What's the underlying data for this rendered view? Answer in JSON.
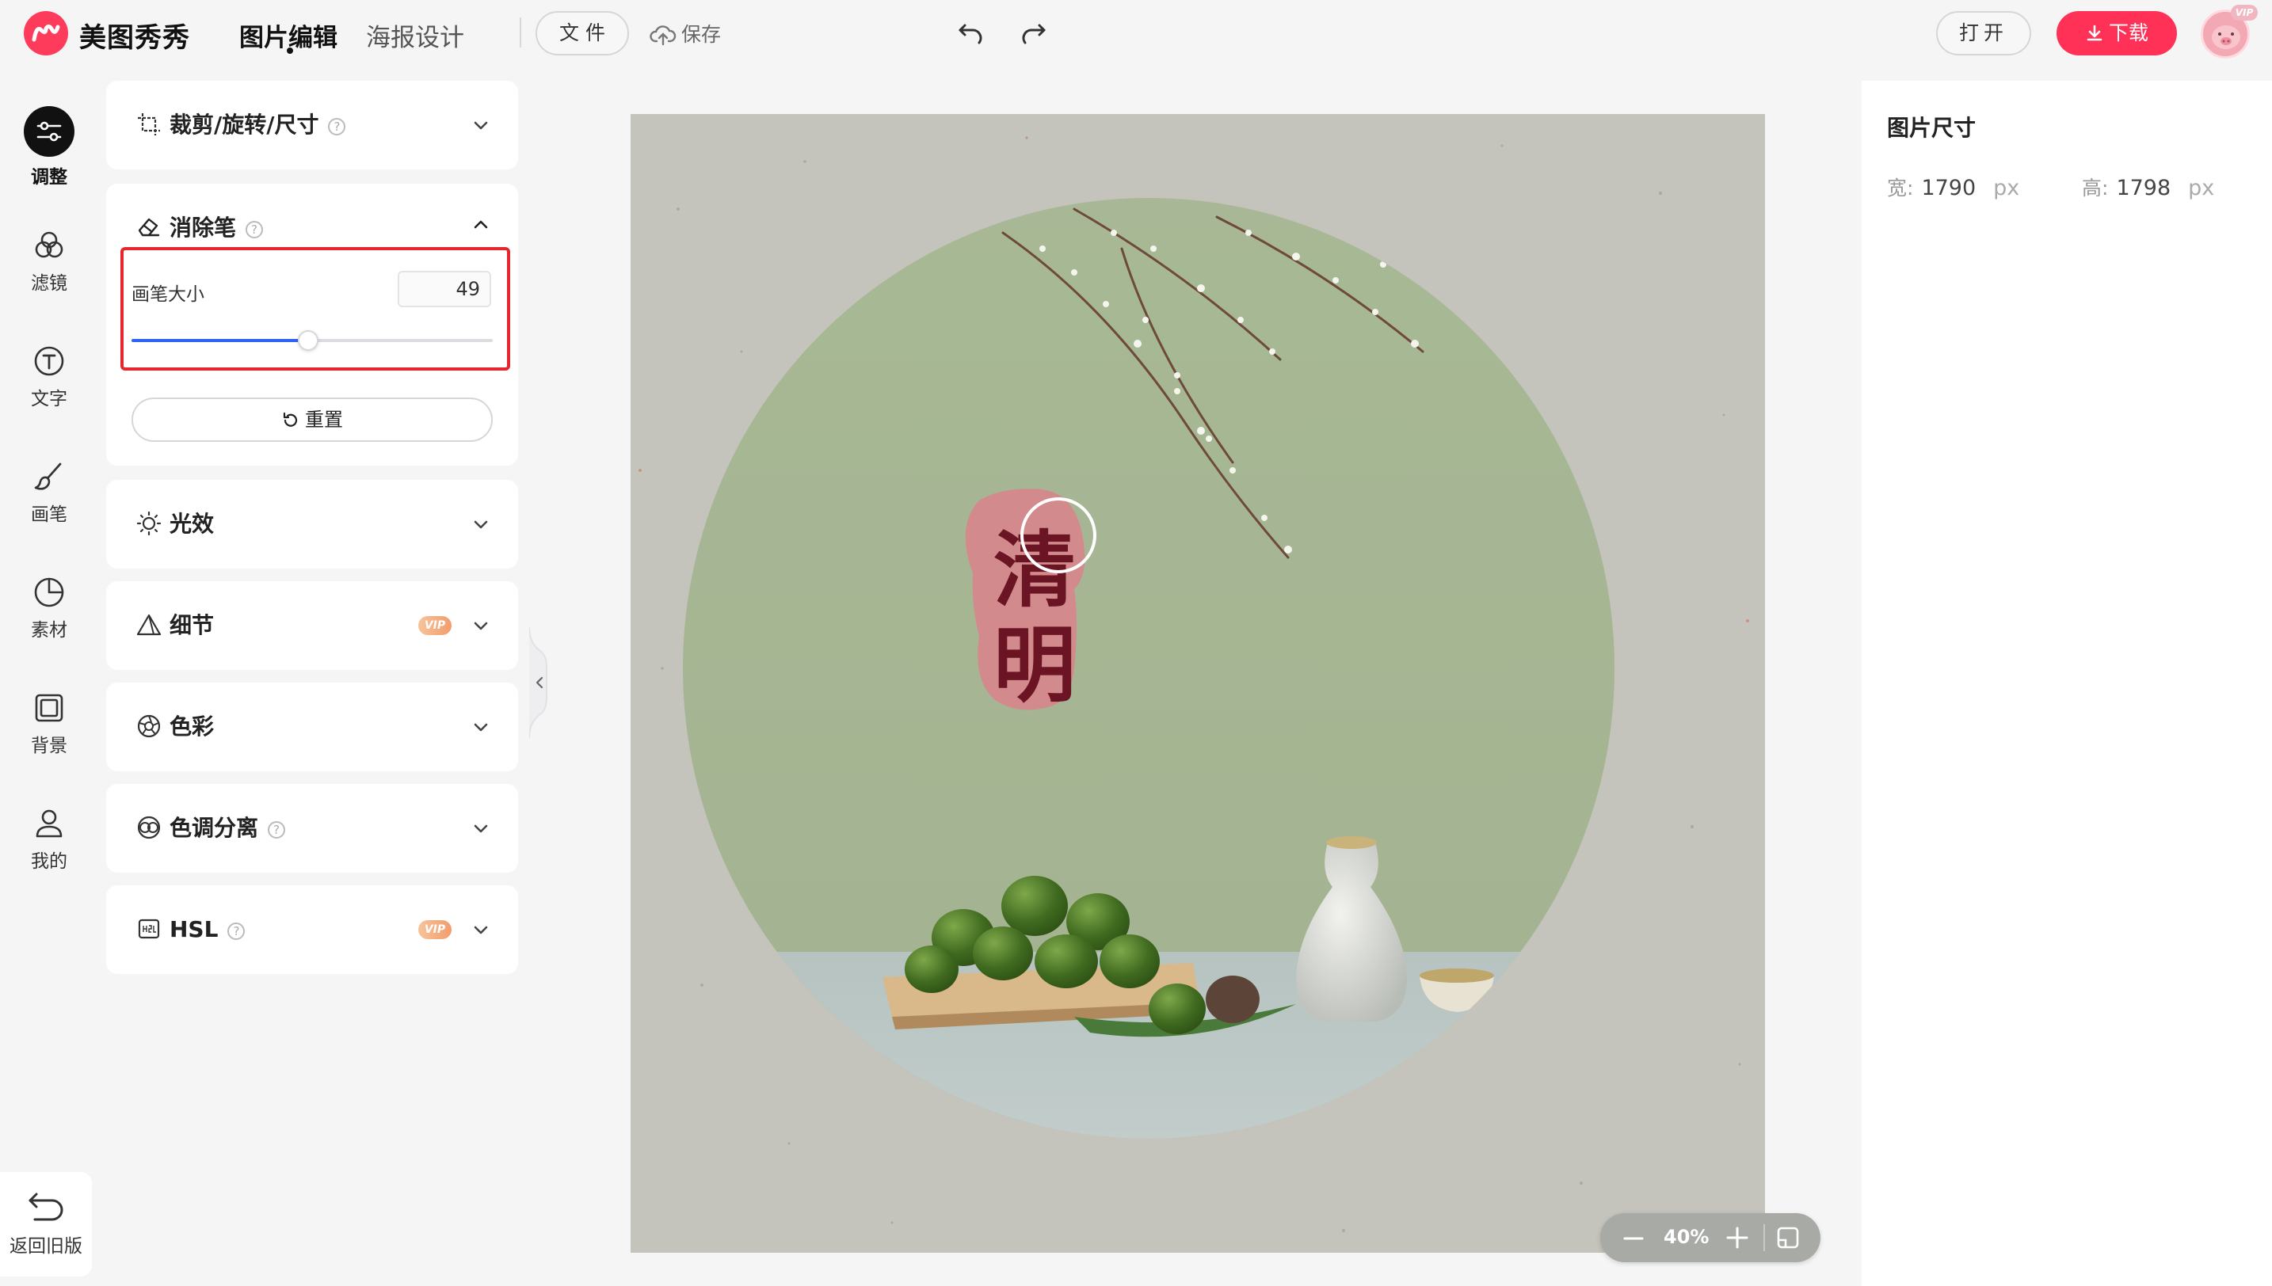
{
  "header": {
    "brand": "美图秀秀",
    "tabs": [
      {
        "label": "图片编辑",
        "active": true
      },
      {
        "label": "海报设计",
        "active": false
      }
    ],
    "file_label": "文 件",
    "save_label": "保存",
    "open_label": "打开",
    "download_label": "下载",
    "avatar_badge": "VIP"
  },
  "rail": {
    "items": [
      {
        "label": "调整",
        "icon": "sliders-icon",
        "active": true
      },
      {
        "label": "滤镜",
        "icon": "filter-icon"
      },
      {
        "label": "文字",
        "icon": "text-icon"
      },
      {
        "label": "画笔",
        "icon": "brush-icon"
      },
      {
        "label": "素材",
        "icon": "sticker-icon"
      },
      {
        "label": "背景",
        "icon": "background-icon"
      },
      {
        "label": "我的",
        "icon": "user-icon"
      }
    ],
    "back_label": "返回旧版"
  },
  "panels": {
    "crop": {
      "label": "裁剪/旋转/尺寸"
    },
    "eraser": {
      "label": "消除笔",
      "brush_size_label": "画笔大小",
      "brush_size_value": "49",
      "brush_size_fraction": 0.49,
      "reset_label": "重置"
    },
    "light": {
      "label": "光效"
    },
    "detail": {
      "label": "细节",
      "badge": "VIP"
    },
    "color": {
      "label": "色彩"
    },
    "split_tone": {
      "label": "色调分离"
    },
    "hsl": {
      "label": "HSL",
      "badge": "VIP"
    }
  },
  "canvas": {
    "poster_text": "清明",
    "zoom": "40%"
  },
  "right_panel": {
    "title": "图片尺寸",
    "width_label": "宽:",
    "width_value": "1790",
    "height_label": "高:",
    "height_value": "1798",
    "unit": "px"
  },
  "colors": {
    "accent": "#ff3156",
    "slider": "#2f63f5",
    "highlight": "#e5262d"
  }
}
